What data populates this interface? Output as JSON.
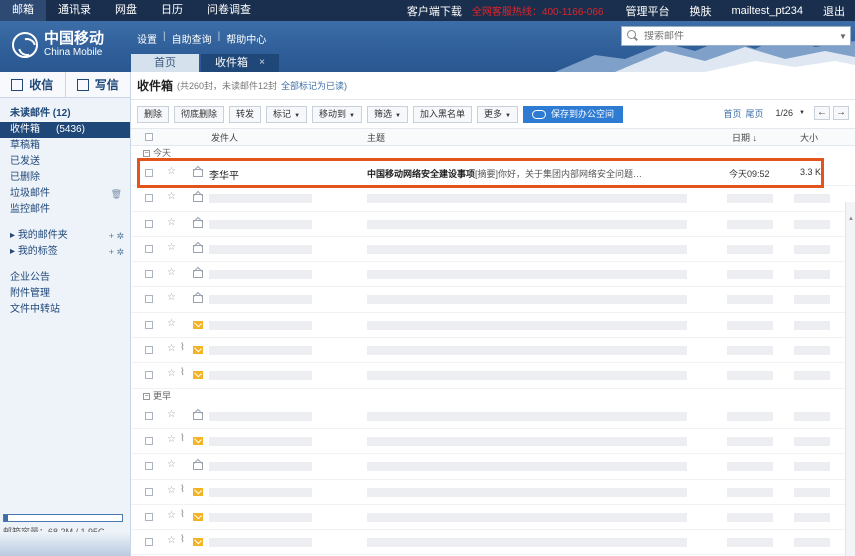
{
  "topnav": {
    "items": [
      "邮箱",
      "通讯录",
      "网盘",
      "日历",
      "问卷调查"
    ],
    "client": "客户端下载",
    "hotline": "全网客服热线：400-1166-066",
    "admin": "管理平台",
    "skin": "换肤",
    "user": "mailtest_pt234",
    "logout": "退出"
  },
  "brand": {
    "cn": "中国移动",
    "en": "China Mobile"
  },
  "sublinks": [
    "设置",
    "自助查询",
    "帮助中心"
  ],
  "search": {
    "placeholder": "搜索邮件"
  },
  "tabs": {
    "home": "首页",
    "inbox": "收件箱",
    "close": "×"
  },
  "sidebar": {
    "receive": "收信",
    "compose": "写信",
    "folders": [
      {
        "label": "未读邮件 (12)",
        "count": ""
      },
      {
        "label": "收件箱",
        "count": "(5436)"
      },
      {
        "label": "草稿箱",
        "count": ""
      },
      {
        "label": "已发送",
        "count": ""
      },
      {
        "label": "已删除",
        "count": ""
      },
      {
        "label": "垃圾邮件",
        "count": ""
      },
      {
        "label": "监控邮件",
        "count": ""
      }
    ],
    "my_folders": "我的邮件夹",
    "my_tags": "我的标签",
    "others": [
      "企业公告",
      "附件管理",
      "文件中转站"
    ],
    "storage_label": "邮箱容量：68.2M / 1.95G",
    "storage_used": 0.035
  },
  "main": {
    "title": "收件箱",
    "meta": "(共260封，未读邮件12封",
    "mark_all": "全部标记为已读)",
    "toolbar": [
      "删除",
      "彻底删除",
      "转发",
      "标记",
      "移动到",
      "筛选",
      "加入黑名单",
      "更多"
    ],
    "save_btn": "保存到办公空间",
    "pager": {
      "first": "首页",
      "last": "尾页",
      "page": "1/26"
    },
    "columns": {
      "sender": "发件人",
      "subject": "主题",
      "date": "日期",
      "size": "大小"
    },
    "group_today": "今天",
    "group_earlier": "更早",
    "first_mail": {
      "sender": "李华平",
      "subject_bold": "中国移动网络安全建设事项",
      "summary": "[摘要]你好，关于集团内部网络安全问题…",
      "date": "今天09:52",
      "size": "3.3 K"
    }
  }
}
